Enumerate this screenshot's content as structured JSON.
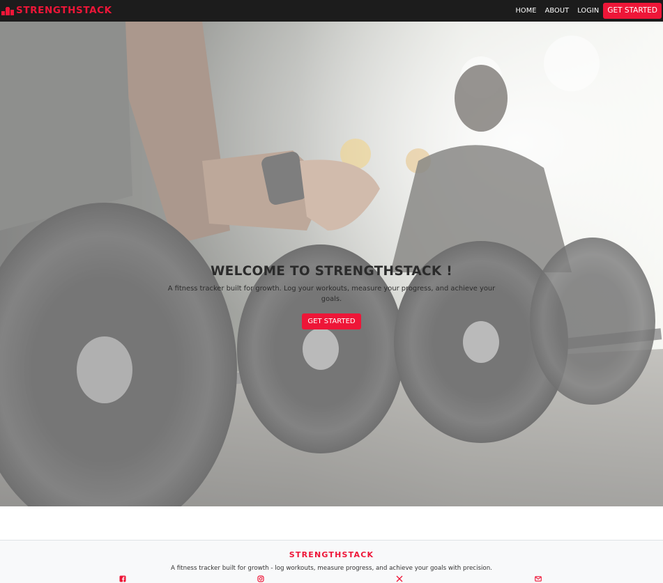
{
  "navbar": {
    "brand": "STRENGTHSTACK",
    "brand_icon": "podium-icon",
    "links": [
      "HOME",
      "ABOUT",
      "LOGIN"
    ],
    "cta": "GET STARTED"
  },
  "hero": {
    "background_image": "gym-barbell-photo",
    "title": "WELCOME TO STRENGTHSTACK !",
    "subtitle": "A fitness tracker built for growth. Log your workouts, measure your progress, and achieve your goals.",
    "cta": "GET STARTED"
  },
  "footer": {
    "brand": "STRENGTHSTACK",
    "tagline": "A fitness tracker built for growth - log workouts, measure progress, and achieve your goals with precision.",
    "social_icons": [
      "facebook-icon",
      "instagram-icon",
      "x-icon",
      "envelope-icon"
    ]
  },
  "colors": {
    "accent": "#ee1638",
    "navbar_bg": "#1c1c1c",
    "footer_bg": "#f8f9fa"
  }
}
